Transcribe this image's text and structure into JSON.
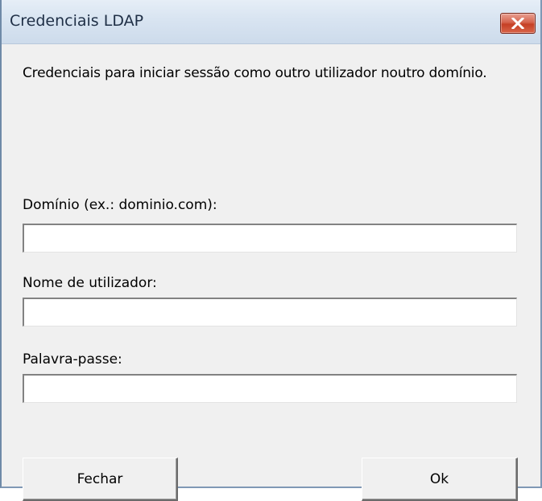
{
  "window": {
    "title": "Credenciais LDAP"
  },
  "dialog": {
    "description": "Credenciais para iniciar sessão como outro utilizador noutro domínio.",
    "domain_label": "Domínio (ex.: dominio.com):",
    "domain_value": "",
    "username_label": "Nome de utilizador:",
    "username_value": "",
    "password_label": "Palavra-passe:",
    "password_value": ""
  },
  "buttons": {
    "close_label": "Fechar",
    "ok_label": "Ok"
  },
  "icons": {
    "close": "close-icon"
  }
}
